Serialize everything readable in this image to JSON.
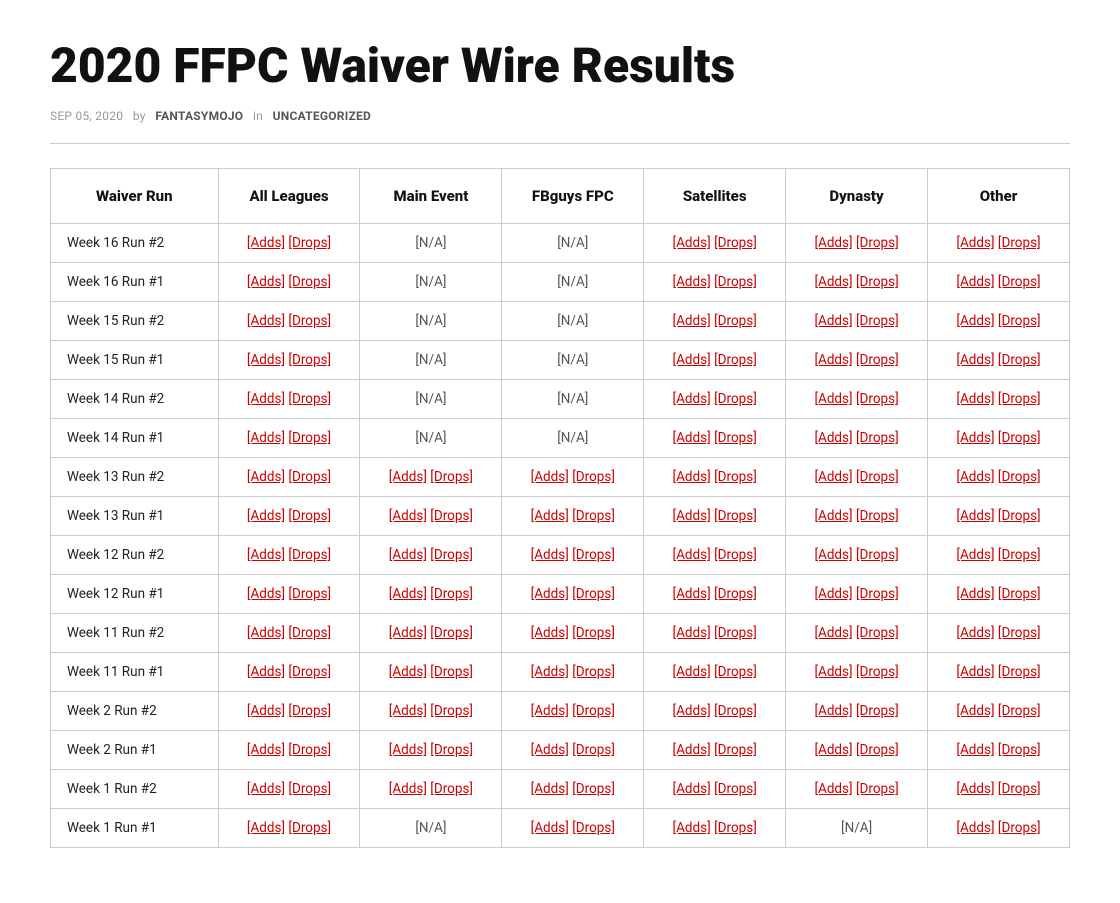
{
  "page": {
    "title": "2020 FFPC Waiver Wire Results",
    "meta": {
      "date": "SEP 05, 2020",
      "by": "by",
      "author": "FANTASYMOJO",
      "in": "in",
      "category": "UNCATEGORIZED"
    }
  },
  "table": {
    "headers": [
      "Waiver Run",
      "All Leagues",
      "Main Event",
      "FBguys FPC",
      "Satellites",
      "Dynasty",
      "Other"
    ],
    "rows": [
      {
        "run": "Week 16 Run #2",
        "allLeagues": {
          "adds": "[Adds]",
          "drops": "[Drops]"
        },
        "mainEvent": {
          "na": "[N/A]"
        },
        "fbguys": {
          "na": "[N/A]"
        },
        "satellites": {
          "adds": "[Adds]",
          "drops": "[Drops]"
        },
        "dynasty": {
          "adds": "[Adds]",
          "drops": "[Drops]"
        },
        "other": {
          "adds": "[Adds]",
          "drops": "[Drops]"
        }
      },
      {
        "run": "Week 16 Run #1",
        "allLeagues": {
          "adds": "[Adds]",
          "drops": "[Drops]"
        },
        "mainEvent": {
          "na": "[N/A]"
        },
        "fbguys": {
          "na": "[N/A]"
        },
        "satellites": {
          "adds": "[Adds]",
          "drops": "[Drops]"
        },
        "dynasty": {
          "adds": "[Adds]",
          "drops": "[Drops]"
        },
        "other": {
          "adds": "[Adds]",
          "drops": "[Drops]"
        }
      },
      {
        "run": "Week 15 Run #2",
        "allLeagues": {
          "adds": "[Adds]",
          "drops": "[Drops]"
        },
        "mainEvent": {
          "na": "[N/A]"
        },
        "fbguys": {
          "na": "[N/A]"
        },
        "satellites": {
          "adds": "[Adds]",
          "drops": "[Drops]"
        },
        "dynasty": {
          "adds": "[Adds]",
          "drops": "[Drops]"
        },
        "other": {
          "adds": "[Adds]",
          "drops": "[Drops]"
        }
      },
      {
        "run": "Week 15 Run #1",
        "allLeagues": {
          "adds": "[Adds]",
          "drops": "[Drops]"
        },
        "mainEvent": {
          "na": "[N/A]"
        },
        "fbguys": {
          "na": "[N/A]"
        },
        "satellites": {
          "adds": "[Adds]",
          "drops": "[Drops]"
        },
        "dynasty": {
          "adds": "[Adds]",
          "drops": "[Drops]"
        },
        "other": {
          "adds": "[Adds]",
          "drops": "[Drops]"
        }
      },
      {
        "run": "Week 14 Run #2",
        "allLeagues": {
          "adds": "[Adds]",
          "drops": "[Drops]"
        },
        "mainEvent": {
          "na": "[N/A]"
        },
        "fbguys": {
          "na": "[N/A]"
        },
        "satellites": {
          "adds": "[Adds]",
          "drops": "[Drops]"
        },
        "dynasty": {
          "adds": "[Adds]",
          "drops": "[Drops]"
        },
        "other": {
          "adds": "[Adds]",
          "drops": "[Drops]"
        }
      },
      {
        "run": "Week 14 Run #1",
        "allLeagues": {
          "adds": "[Adds]",
          "drops": "[Drops]"
        },
        "mainEvent": {
          "na": "[N/A]"
        },
        "fbguys": {
          "na": "[N/A]"
        },
        "satellites": {
          "adds": "[Adds]",
          "drops": "[Drops]"
        },
        "dynasty": {
          "adds": "[Adds]",
          "drops": "[Drops]"
        },
        "other": {
          "adds": "[Adds]",
          "drops": "[Drops]"
        }
      },
      {
        "run": "Week 13 Run #2",
        "allLeagues": {
          "adds": "[Adds]",
          "drops": "[Drops]"
        },
        "mainEvent": {
          "adds": "[Adds]",
          "drops": "[Drops]"
        },
        "fbguys": {
          "adds": "[Adds]",
          "drops": "[Drops]"
        },
        "satellites": {
          "adds": "[Adds]",
          "drops": "[Drops]"
        },
        "dynasty": {
          "adds": "[Adds]",
          "drops": "[Drops]"
        },
        "other": {
          "adds": "[Adds]",
          "drops": "[Drops]"
        }
      },
      {
        "run": "Week 13 Run #1",
        "allLeagues": {
          "adds": "[Adds]",
          "drops": "[Drops]"
        },
        "mainEvent": {
          "adds": "[Adds]",
          "drops": "[Drops]"
        },
        "fbguys": {
          "adds": "[Adds]",
          "drops": "[Drops]"
        },
        "satellites": {
          "adds": "[Adds]",
          "drops": "[Drops]"
        },
        "dynasty": {
          "adds": "[Adds]",
          "drops": "[Drops]"
        },
        "other": {
          "adds": "[Adds]",
          "drops": "[Drops]"
        }
      },
      {
        "run": "Week 12 Run #2",
        "allLeagues": {
          "adds": "[Adds]",
          "drops": "[Drops]"
        },
        "mainEvent": {
          "adds": "[Adds]",
          "drops": "[Drops]"
        },
        "fbguys": {
          "adds": "[Adds]",
          "drops": "[Drops]"
        },
        "satellites": {
          "adds": "[Adds]",
          "drops": "[Drops]"
        },
        "dynasty": {
          "adds": "[Adds]",
          "drops": "[Drops]"
        },
        "other": {
          "adds": "[Adds]",
          "drops": "[Drops]"
        }
      },
      {
        "run": "Week 12 Run #1",
        "allLeagues": {
          "adds": "[Adds]",
          "drops": "[Drops]"
        },
        "mainEvent": {
          "adds": "[Adds]",
          "drops": "[Drops]"
        },
        "fbguys": {
          "adds": "[Adds]",
          "drops": "[Drops]"
        },
        "satellites": {
          "adds": "[Adds]",
          "drops": "[Drops]"
        },
        "dynasty": {
          "adds": "[Adds]",
          "drops": "[Drops]"
        },
        "other": {
          "adds": "[Adds]",
          "drops": "[Drops]"
        }
      },
      {
        "run": "Week 11 Run #2",
        "allLeagues": {
          "adds": "[Adds]",
          "drops": "[Drops]"
        },
        "mainEvent": {
          "adds": "[Adds]",
          "drops": "[Drops]"
        },
        "fbguys": {
          "adds": "[Adds]",
          "drops": "[Drops]"
        },
        "satellites": {
          "adds": "[Adds]",
          "drops": "[Drops]"
        },
        "dynasty": {
          "adds": "[Adds]",
          "drops": "[Drops]"
        },
        "other": {
          "adds": "[Adds]",
          "drops": "[Drops]"
        }
      },
      {
        "run": "Week 11 Run #1",
        "allLeagues": {
          "adds": "[Adds]",
          "drops": "[Drops]"
        },
        "mainEvent": {
          "adds": "[Adds]",
          "drops": "[Drops]"
        },
        "fbguys": {
          "adds": "[Adds]",
          "drops": "[Drops]"
        },
        "satellites": {
          "adds": "[Adds]",
          "drops": "[Drops]"
        },
        "dynasty": {
          "adds": "[Adds]",
          "drops": "[Drops]"
        },
        "other": {
          "adds": "[Adds]",
          "drops": "[Drops]"
        }
      },
      {
        "run": "Week 2 Run #2",
        "allLeagues": {
          "adds": "[Adds]",
          "drops": "[Drops]"
        },
        "mainEvent": {
          "adds": "[Adds]",
          "drops": "[Drops]"
        },
        "fbguys": {
          "adds": "[Adds]",
          "drops": "[Drops]"
        },
        "satellites": {
          "adds": "[Adds]",
          "drops": "[Drops]"
        },
        "dynasty": {
          "adds": "[Adds]",
          "drops": "[Drops]"
        },
        "other": {
          "adds": "[Adds]",
          "drops": "[Drops]"
        }
      },
      {
        "run": "Week 2 Run #1",
        "allLeagues": {
          "adds": "[Adds]",
          "drops": "[Drops]"
        },
        "mainEvent": {
          "adds": "[Adds]",
          "drops": "[Drops]"
        },
        "fbguys": {
          "adds": "[Adds]",
          "drops": "[Drops]"
        },
        "satellites": {
          "adds": "[Adds]",
          "drops": "[Drops]"
        },
        "dynasty": {
          "adds": "[Adds]",
          "drops": "[Drops]"
        },
        "other": {
          "adds": "[Adds]",
          "drops": "[Drops]"
        }
      },
      {
        "run": "Week 1 Run #2",
        "allLeagues": {
          "adds": "[Adds]",
          "drops": "[Drops]"
        },
        "mainEvent": {
          "adds": "[Adds]",
          "drops": "[Drops]"
        },
        "fbguys": {
          "adds": "[Adds]",
          "drops": "[Drops]"
        },
        "satellites": {
          "adds": "[Adds]",
          "drops": "[Drops]"
        },
        "dynasty": {
          "adds": "[Adds]",
          "drops": "[Drops]"
        },
        "other": {
          "adds": "[Adds]",
          "drops": "[Drops]"
        }
      },
      {
        "run": "Week 1 Run #1",
        "allLeagues": {
          "adds": "[Adds]",
          "drops": "[Drops]"
        },
        "mainEvent": {
          "na": "[N/A]"
        },
        "fbguys": {
          "adds": "[Adds]",
          "drops": "[Drops]"
        },
        "satellites": {
          "adds": "[Adds]",
          "drops": "[Drops]"
        },
        "dynasty": {
          "na": "[N/A]"
        },
        "other": {
          "adds": "[Adds]",
          "drops": "[Drops]"
        }
      }
    ]
  }
}
